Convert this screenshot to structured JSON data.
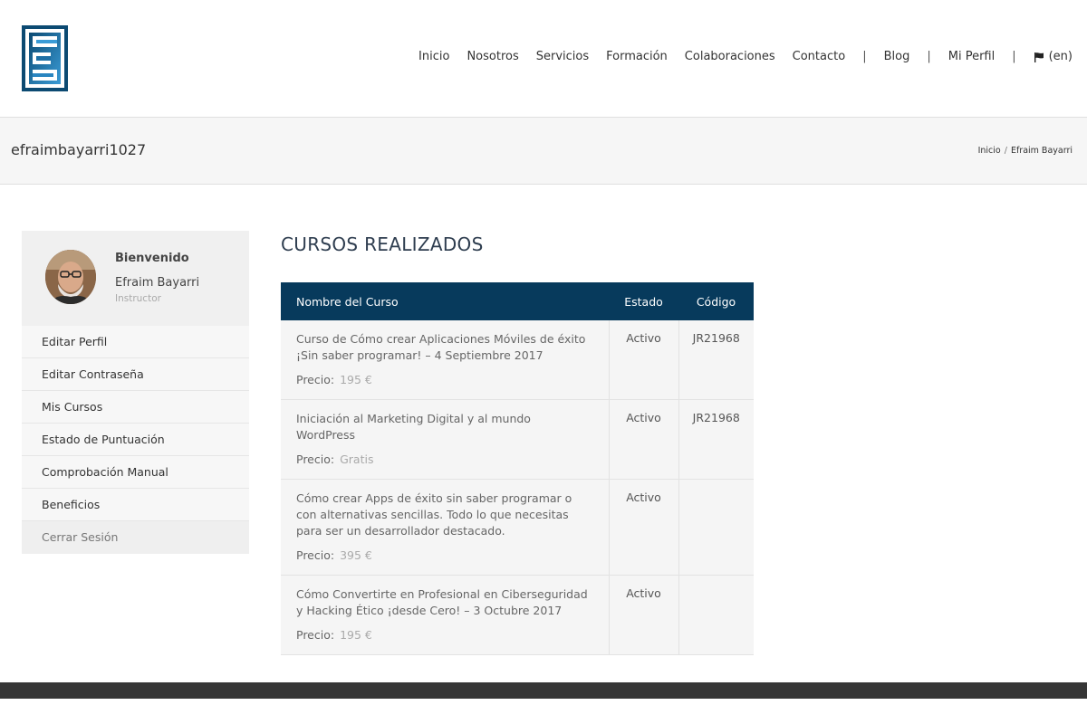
{
  "header": {
    "logo_icon": "stacked-brackets-logo-icon",
    "nav": [
      {
        "label": "Inicio"
      },
      {
        "label": "Nosotros"
      },
      {
        "label": "Servicios"
      },
      {
        "label": "Formación"
      },
      {
        "label": "Colaboraciones"
      },
      {
        "label": "Contacto"
      }
    ],
    "separator": "|",
    "blog": "Blog",
    "profile": "Mi Perfil",
    "lang": "(en)",
    "flag_icon": "flag-icon"
  },
  "titlebar": {
    "title": "efraimbayarri1027",
    "breadcrumb": [
      "Inicio",
      "Efraim Bayarri"
    ],
    "breadcrumb_sep": "/"
  },
  "sidebar": {
    "welcome": "Bienvenido",
    "name": "Efraim Bayarri",
    "role": "Instructor",
    "menu": [
      {
        "label": "Editar Perfil"
      },
      {
        "label": "Editar Contraseña"
      },
      {
        "label": "Mis Cursos"
      },
      {
        "label": "Estado de Puntuación"
      },
      {
        "label": "Comprobación Manual"
      },
      {
        "label": "Beneficios"
      }
    ],
    "logout": "Cerrar Sesión"
  },
  "main": {
    "title": "CURSOS REALIZADOS",
    "columns": [
      "Nombre del Curso",
      "Estado",
      "Código"
    ],
    "price_label": "Precio:",
    "rows": [
      {
        "name": "Curso de Cómo crear Aplicaciones Móviles de éxito ¡Sin saber programar! – 4 Septiembre 2017",
        "price": "195 €",
        "status": "Activo",
        "code": "JR21968"
      },
      {
        "name": "Iniciación al Marketing Digital y al mundo WordPress",
        "price": "Gratis",
        "status": "Activo",
        "code": "JR21968"
      },
      {
        "name": "Cómo crear Apps de éxito sin saber programar o con alternativas sencillas. Todo lo que necesitas para ser un desarrollador destacado.",
        "price": "395 €",
        "status": "Activo",
        "code": ""
      },
      {
        "name": "Cómo Convertirte en Profesional en Ciberseguridad y Hacking Ético ¡desde Cero! – 3 Octubre 2017",
        "price": "195 €",
        "status": "Activo",
        "code": ""
      }
    ]
  },
  "colors": {
    "header_table": "#073a5c",
    "logo_dark": "#0c4a72",
    "logo_light": "#3a9bd6",
    "footer": "#363636"
  }
}
